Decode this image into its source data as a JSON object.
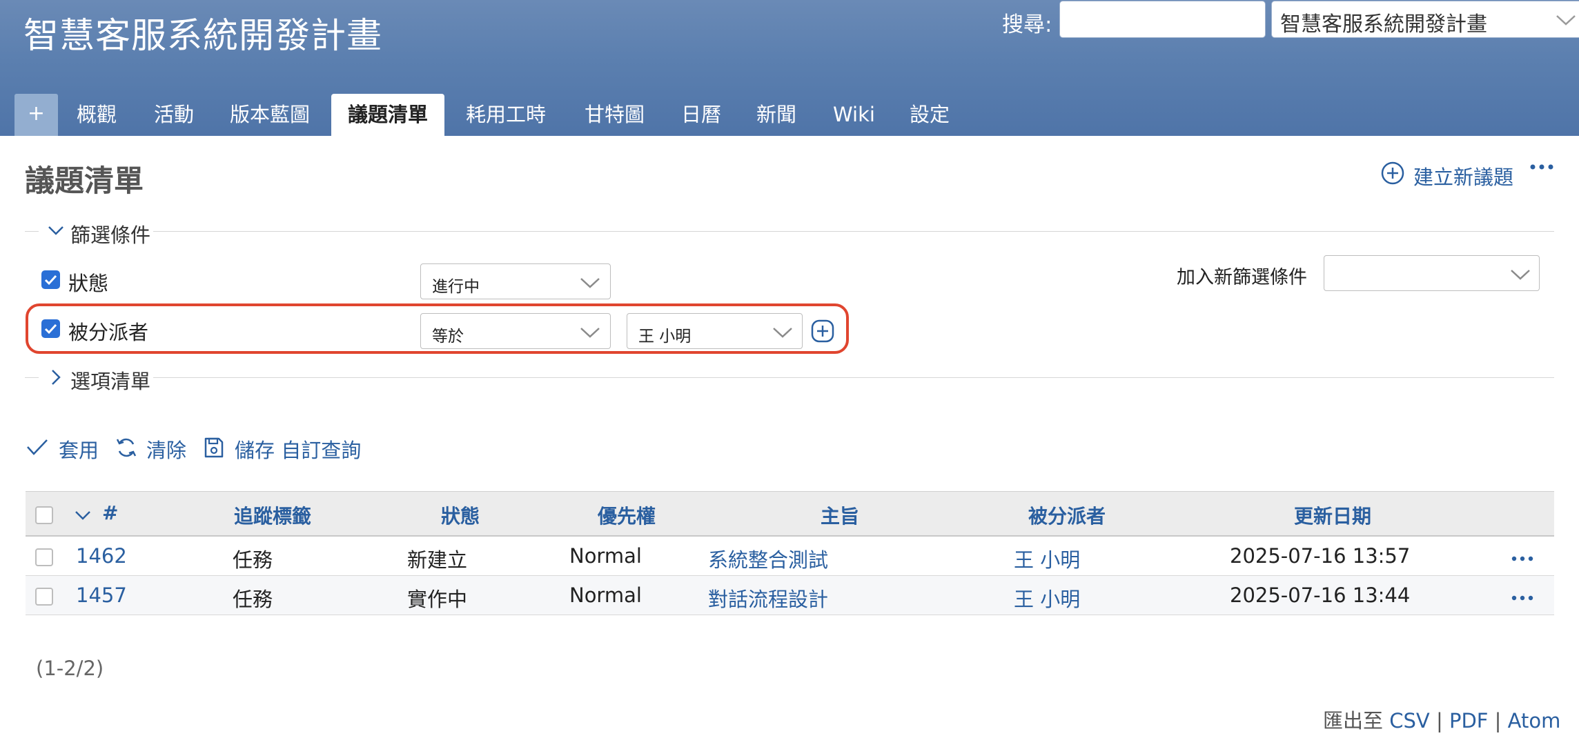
{
  "header": {
    "project_title": "智慧客服系統開發計畫",
    "search_label": "搜尋:",
    "search_value": "",
    "project_select": "智慧客服系統開發計畫"
  },
  "tabs": {
    "plus": "+",
    "items": [
      "概觀",
      "活動",
      "版本藍圖",
      "議題清單",
      "耗用工時",
      "甘特圖",
      "日曆",
      "新聞",
      "Wiki",
      "設定"
    ],
    "selected": "議題清單"
  },
  "page": {
    "title": "議題清單",
    "new_issue": "建立新議題"
  },
  "filters": {
    "legend": "篩選條件",
    "status_label": "狀態",
    "status_operator": "進行中",
    "assignee_label": "被分派者",
    "assignee_operator": "等於",
    "assignee_value": "王 小明",
    "add_filter_label": "加入新篩選條件",
    "add_filter_value": ""
  },
  "options": {
    "legend": "選項清單"
  },
  "actions": {
    "apply": "套用",
    "clear": "清除",
    "save": "儲存 自訂查詢"
  },
  "table": {
    "columns": [
      "#",
      "追蹤標籤",
      "狀態",
      "優先權",
      "主旨",
      "被分派者",
      "更新日期"
    ],
    "rows": [
      {
        "id": "1462",
        "tracker": "任務",
        "status": "新建立",
        "priority": "Normal",
        "subject": "系統整合測試",
        "assignee": "王 小明",
        "updated": "2025-07-16 13:57"
      },
      {
        "id": "1457",
        "tracker": "任務",
        "status": "實作中",
        "priority": "Normal",
        "subject": "對話流程設計",
        "assignee": "王 小明",
        "updated": "2025-07-16 13:44"
      }
    ]
  },
  "footer": {
    "count": "(1-2/2)",
    "export_prefix": "匯出至",
    "csv": "CSV",
    "pdf": "PDF",
    "atom": "Atom",
    "separator": "|"
  },
  "colors": {
    "header_bg": "#5b7faf",
    "link": "#2a5fa0",
    "checkbox": "#2a6fd6",
    "highlight": "#e0452f"
  }
}
